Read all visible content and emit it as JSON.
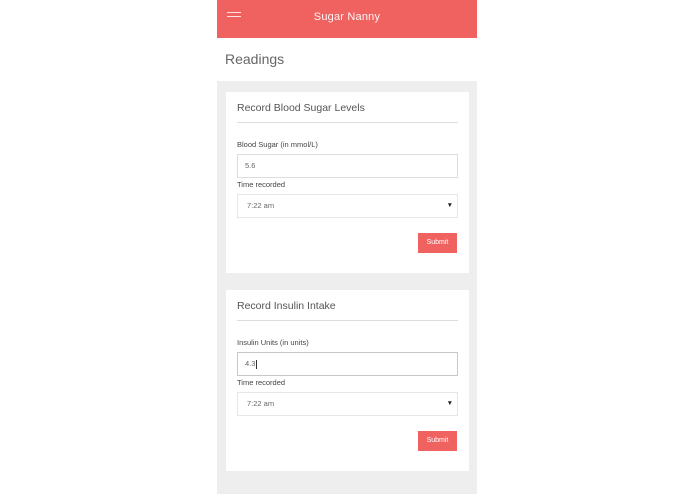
{
  "header": {
    "app_title": "Sugar Nanny",
    "menu_icon": "hamburger-menu-icon",
    "color": "#f06260"
  },
  "page": {
    "title": "Readings"
  },
  "blood_sugar_card": {
    "title": "Record Blood Sugar Levels",
    "value_label": "Blood Sugar (in mmol/L)",
    "value": "5.6",
    "time_label": "Time recorded",
    "time_value": "7:22 am",
    "submit_label": "Submit"
  },
  "insulin_card": {
    "title": "Record Insulin Intake",
    "value_label": "Insulin Units (in units)",
    "value": "4.3",
    "time_label": "Time recorded",
    "time_value": "7:22 am",
    "submit_label": "Submit"
  },
  "select_arrow_icon": "caret-down-icon"
}
